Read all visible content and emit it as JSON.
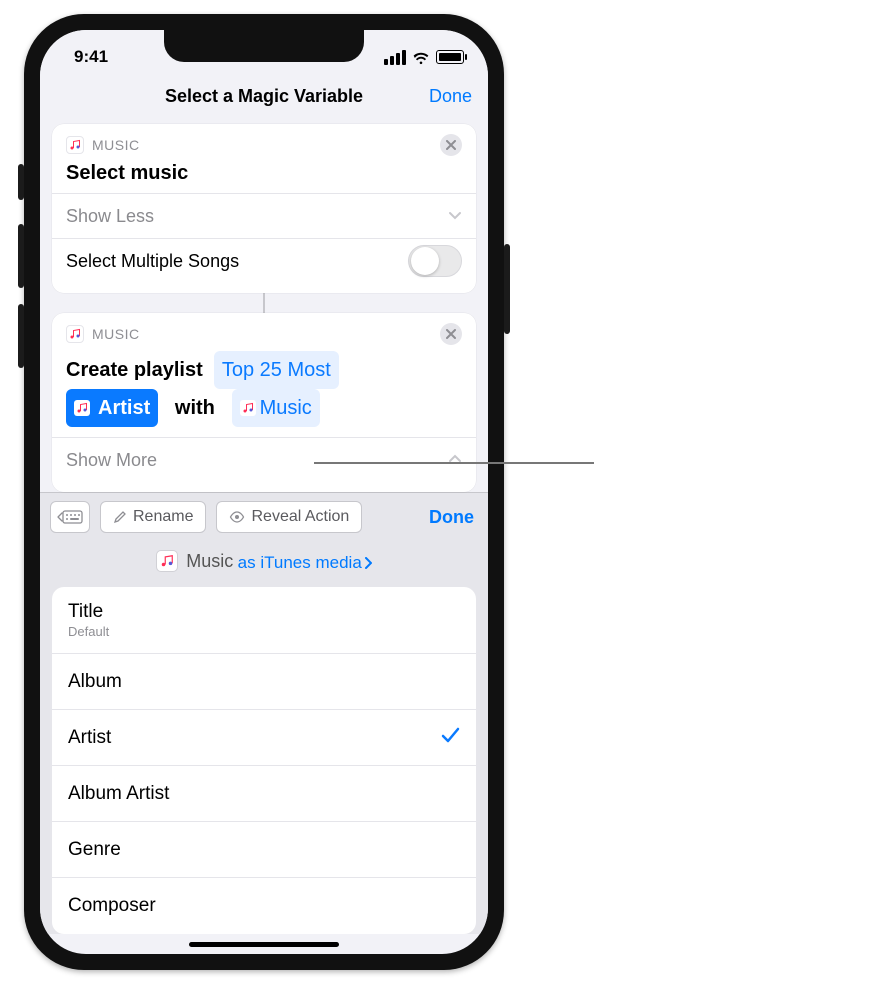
{
  "status": {
    "time": "9:41"
  },
  "nav": {
    "title": "Select a Magic Variable",
    "done": "Done"
  },
  "card_music1": {
    "app_label": "MUSIC",
    "title": "Select music",
    "showless": "Show Less",
    "select_multiple": "Select Multiple Songs"
  },
  "card_music2": {
    "app_label": "MUSIC",
    "create": "Create playlist",
    "top25": "Top 25 Most",
    "artist": "Artist",
    "with": "with",
    "music_token": "Music",
    "showmore": "Show More"
  },
  "toolbar": {
    "rename": "Rename",
    "reveal": "Reveal Action",
    "done": "Done"
  },
  "var_preview": {
    "name": "Music",
    "as": "as iTunes media"
  },
  "properties": [
    {
      "label": "Title",
      "sub": "Default",
      "checked": false
    },
    {
      "label": "Album",
      "checked": false
    },
    {
      "label": "Artist",
      "checked": true
    },
    {
      "label": "Album Artist",
      "checked": false
    },
    {
      "label": "Genre",
      "checked": false
    },
    {
      "label": "Composer",
      "checked": false
    }
  ]
}
